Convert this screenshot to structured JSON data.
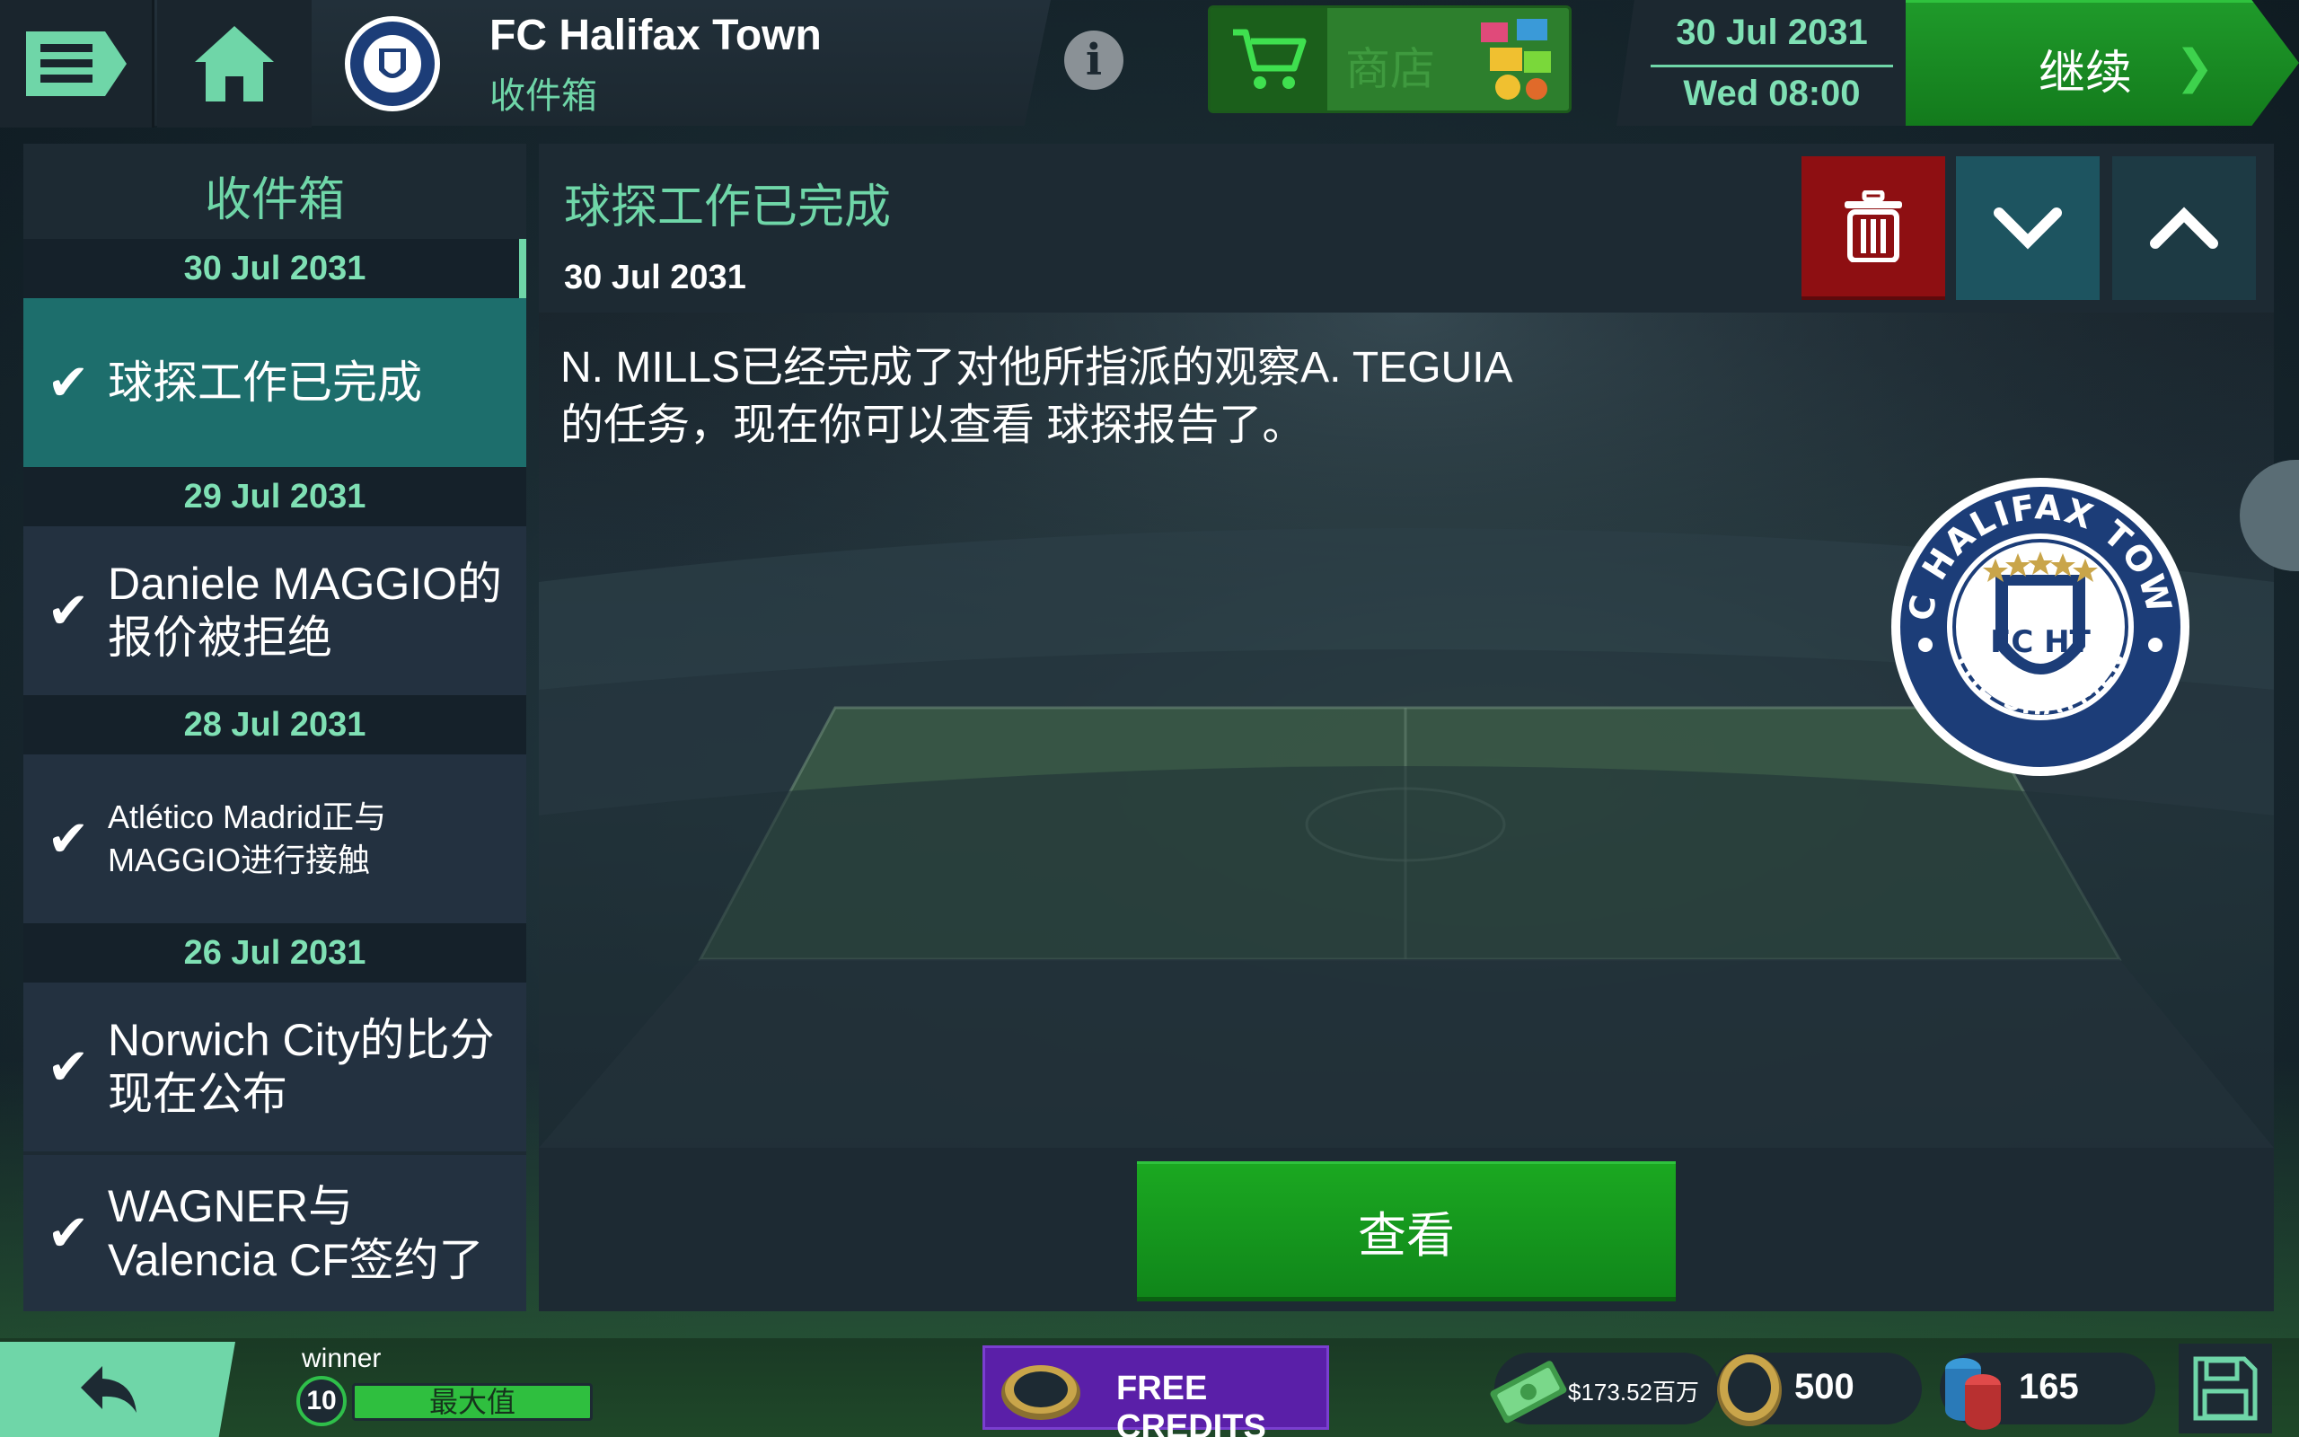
{
  "header": {
    "club_name": "FC Halifax Town",
    "section": "收件箱",
    "shop_label": "商店",
    "date": "30 Jul 2031",
    "day_time": "Wed 08:00",
    "continue_label": "继续"
  },
  "inbox": {
    "title": "收件箱",
    "groups": [
      {
        "date": "30 Jul 2031",
        "items": [
          {
            "text": "球探工作已完成",
            "selected": true
          }
        ]
      },
      {
        "date": "29 Jul 2031",
        "items": [
          {
            "text": "Daniele MAGGIO的报价被拒绝"
          }
        ]
      },
      {
        "date": "28 Jul 2031",
        "items": [
          {
            "text": "Atlético Madrid正与MAGGIO进行接触"
          }
        ]
      },
      {
        "date": "26 Jul 2031",
        "items": [
          {
            "text": "Norwich City的比分现在公布"
          },
          {
            "text": "WAGNER与Valencia CF签约了"
          }
        ]
      }
    ]
  },
  "message": {
    "subject": "球探工作已完成",
    "date": "30 Jul 2031",
    "body": "N. MILLS已经完成了对他所指派的观察A. TEGUIA的任务，现在你可以查看 球探报告了。",
    "view_label": "查看",
    "crest_text_top": "FC HALIFAX TOWN",
    "crest_text_bottom": "THE SHAYMEN",
    "crest_monogram": "FC HT"
  },
  "footer": {
    "user_name": "winner",
    "level": "10",
    "xp_label": "最大值",
    "free_credits_label": "FREE CREDITS",
    "money": "$173.52百万",
    "coins": "500",
    "gems": "165"
  },
  "colors": {
    "accent": "#6fd6a8",
    "panel": "#1d2a33",
    "selected": "#1d6e6c",
    "delete": "#8e0f12",
    "primary_button": "#1ba821",
    "credits": "#5a1fa8"
  }
}
